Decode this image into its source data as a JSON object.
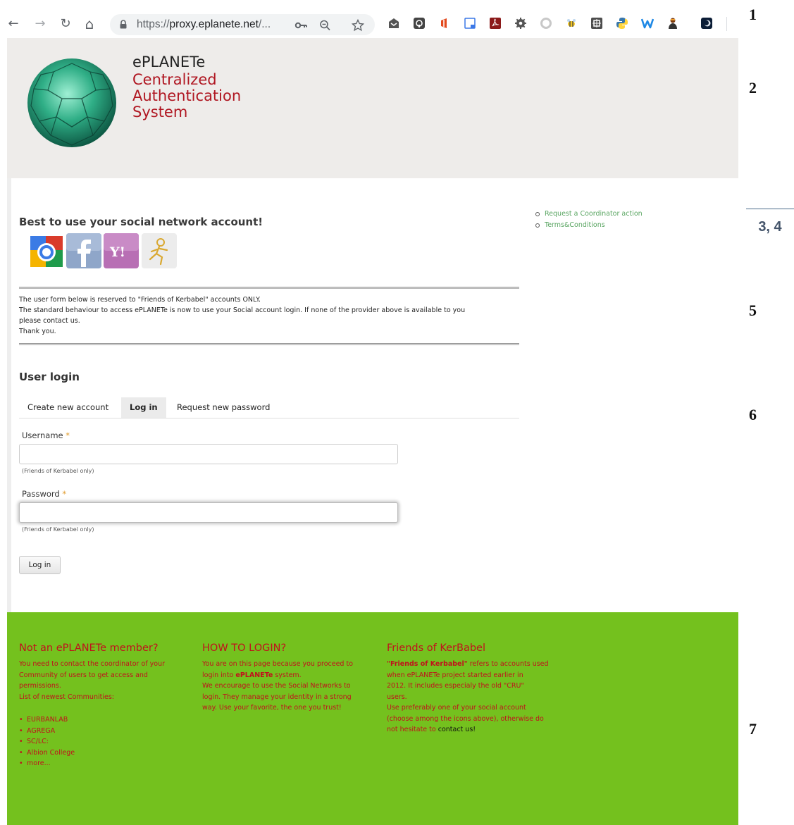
{
  "browser": {
    "url_prefix": "https://",
    "url_host": "proxy.eplanete.net",
    "url_suffix": "/...",
    "nav": {
      "back": "←",
      "forward": "→",
      "reload": "↻",
      "home": "⌂"
    }
  },
  "markers": {
    "m1": "1",
    "m2": "2",
    "m34": "3, 4",
    "m5": "5",
    "m6": "6",
    "m7": "7"
  },
  "header": {
    "title": "ePLANETe",
    "subtitle_lines": [
      "Centralized",
      "Authentication",
      "System"
    ]
  },
  "side_links": [
    "Request a Coordinator action",
    "Terms&Conditions"
  ],
  "social": {
    "title": "Best to use your social network account!",
    "providers": [
      "Google",
      "Facebook",
      "Yahoo",
      "AIM"
    ]
  },
  "notice": {
    "line1": "The user form below is reserved to \"Friends of Kerbabel\" accounts ONLY.",
    "line2": "The standard behaviour to access ePLANETe is now to use your Social account login. If none of the provider above is available to you",
    "line3": "please contact us.",
    "line4": "Thank you."
  },
  "login": {
    "title": "User login",
    "tabs": [
      "Create new account",
      "Log in",
      "Request new password"
    ],
    "username_label": "Username",
    "password_label": "Password",
    "required_mark": "*",
    "username_hint": "(Friends of Kerbabel only)",
    "password_hint": "(Friends of Kerbabel only)",
    "username_value": "",
    "password_value": "",
    "submit": "Log in"
  },
  "footer": {
    "col1": {
      "title": "Not an ePLANETe member?",
      "lines": [
        "You need to contact the coordinator of your",
        "Community of users to get access and",
        "permissions.",
        "List of newest Communities:"
      ],
      "communities": [
        "EURBANLAB",
        "AGREGA",
        "SC/LC:",
        "Albion College",
        "more..."
      ]
    },
    "col2": {
      "title": "HOW TO LOGIN?",
      "line1": "You are on this page because you proceed to",
      "line2_pre": "login into ",
      "line2_em": "ePLANETe",
      "line2_post": " system.",
      "lines": [
        "We encourage to use the Social Networks to",
        "login. They manage your identity in a strong",
        "way. Use your favorite, the one you trust!"
      ]
    },
    "col3": {
      "title": "Friends of KerBabel",
      "line1_em": "\"Friends of Kerbabel\"",
      "line1_post": " refers to accounts used",
      "lines": [
        "when ePLANETe project started earlier in",
        "2012. It includes especialy the old \"CRU\"",
        "users.",
        "Use preferably one of your social account",
        "(choose among the icons above), otherwise do"
      ],
      "last_pre": "not hesitate to ",
      "contact_link": "contact us!"
    }
  }
}
